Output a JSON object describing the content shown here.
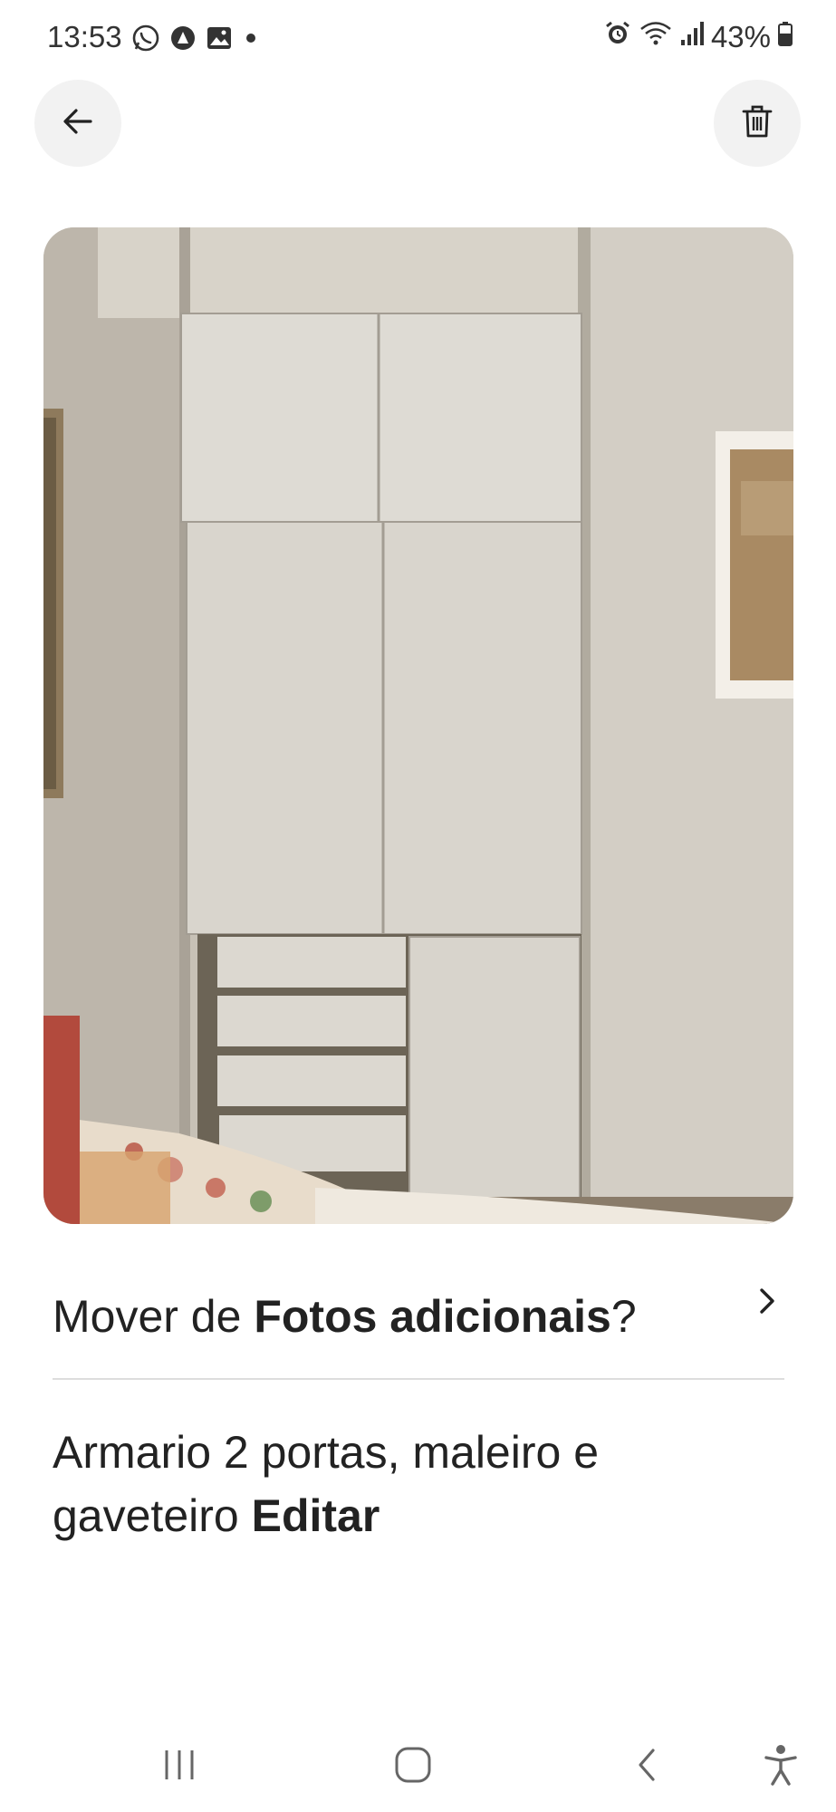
{
  "status_bar": {
    "time": "13:53",
    "battery": "43%",
    "left_icons": [
      "whatsapp-icon",
      "notification-icon",
      "gallery-icon",
      "dot-icon"
    ],
    "right_icons": [
      "alarm-icon",
      "wifi-icon",
      "signal-icon",
      "battery-icon"
    ]
  },
  "header": {
    "back_icon": "arrow-left-icon",
    "delete_icon": "trash-icon"
  },
  "move_prompt": {
    "prefix": "Mover de ",
    "album": "Fotos adicionais",
    "suffix": "?"
  },
  "caption": {
    "text": "Armario 2 portas, maleiro e gaveteiro",
    "edit_label": "Editar"
  },
  "nav_bar": {
    "icons": [
      "recent-apps-icon",
      "home-icon",
      "back-icon",
      "accessibility-icon"
    ]
  },
  "colors": {
    "text": "#222222",
    "button_bg": "#f2f2f2",
    "divider": "#dddddd"
  }
}
